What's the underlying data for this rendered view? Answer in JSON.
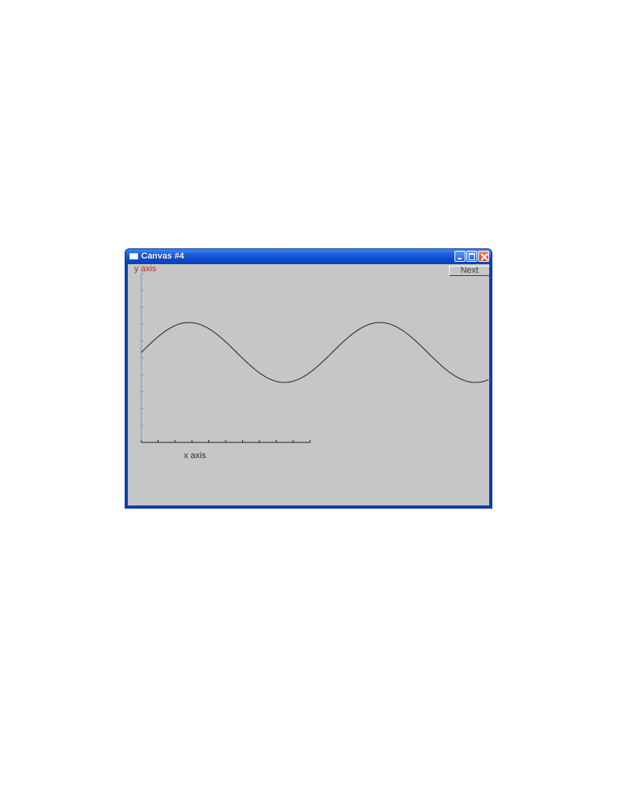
{
  "window": {
    "title": "Canvas #4",
    "next_label": "Next"
  },
  "chart_data": {
    "type": "line",
    "xlabel": "x axis",
    "ylabel": "y axis",
    "x_ticks": 10,
    "y_ticks": 10,
    "series": [
      {
        "values_note": "",
        "amplitude": 1,
        "periods_visible": 1.9
      }
    ],
    "colors": {
      "y_axis": "#4aa8c0",
      "x_axis": "#202020",
      "ylabel": "#b03030",
      "curve": "#202020"
    }
  }
}
